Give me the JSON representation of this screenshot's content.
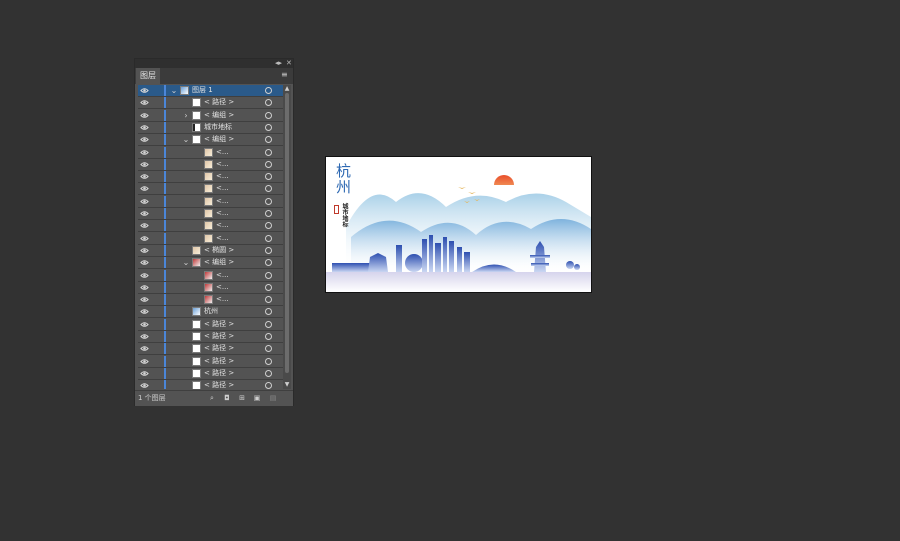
{
  "panel": {
    "tab_label": "图层",
    "footer_count": "1 个图层"
  },
  "layers": [
    {
      "label": "图层 1",
      "indent": 0,
      "arrow": "⌄",
      "thumb": "blue",
      "selected": true
    },
    {
      "label": "< 路径 >",
      "indent": 1,
      "arrow": "",
      "thumb": "white"
    },
    {
      "label": "< 编组 >",
      "indent": 1,
      "arrow": "›",
      "thumb": "white"
    },
    {
      "label": "城市地标",
      "indent": 1,
      "arrow": "",
      "thumb": "dark"
    },
    {
      "label": "< 编组 >",
      "indent": 1,
      "arrow": "⌄",
      "thumb": "white"
    },
    {
      "label": "<...",
      "indent": 2,
      "arrow": "",
      "thumb": "fig"
    },
    {
      "label": "<...",
      "indent": 2,
      "arrow": "",
      "thumb": "fig"
    },
    {
      "label": "<...",
      "indent": 2,
      "arrow": "",
      "thumb": "fig"
    },
    {
      "label": "<...",
      "indent": 2,
      "arrow": "",
      "thumb": "fig"
    },
    {
      "label": "<...",
      "indent": 2,
      "arrow": "",
      "thumb": "fig"
    },
    {
      "label": "<...",
      "indent": 2,
      "arrow": "",
      "thumb": "fig"
    },
    {
      "label": "<...",
      "indent": 2,
      "arrow": "",
      "thumb": "fig"
    },
    {
      "label": "<...",
      "indent": 2,
      "arrow": "",
      "thumb": "fig"
    },
    {
      "label": "< 椭圆 >",
      "indent": 1,
      "arrow": "",
      "thumb": "fig"
    },
    {
      "label": "< 编组 >",
      "indent": 1,
      "arrow": "⌄",
      "thumb": "red"
    },
    {
      "label": "<...",
      "indent": 2,
      "arrow": "",
      "thumb": "red"
    },
    {
      "label": "<...",
      "indent": 2,
      "arrow": "",
      "thumb": "red"
    },
    {
      "label": "<...",
      "indent": 2,
      "arrow": "",
      "thumb": "red"
    },
    {
      "label": "杭州",
      "indent": 1,
      "arrow": "",
      "thumb": "blue"
    },
    {
      "label": "< 路径 >",
      "indent": 1,
      "arrow": "",
      "thumb": "white"
    },
    {
      "label": "< 路径 >",
      "indent": 1,
      "arrow": "",
      "thumb": "white"
    },
    {
      "label": "< 路径 >",
      "indent": 1,
      "arrow": "",
      "thumb": "white"
    },
    {
      "label": "< 路径 >",
      "indent": 1,
      "arrow": "",
      "thumb": "white"
    },
    {
      "label": "< 路径 >",
      "indent": 1,
      "arrow": "",
      "thumb": "white"
    },
    {
      "label": "< 路径 >",
      "indent": 1,
      "arrow": "",
      "thumb": "white"
    }
  ],
  "artboard": {
    "title": "杭州",
    "subtitle": "城市地标"
  },
  "colors": {
    "accent": "#4b86d8",
    "selected_row": "#2a5a8a",
    "canvas_bg": "#323232",
    "mountain_blue": "#9cc7e3",
    "sun": "#e96a2c"
  }
}
